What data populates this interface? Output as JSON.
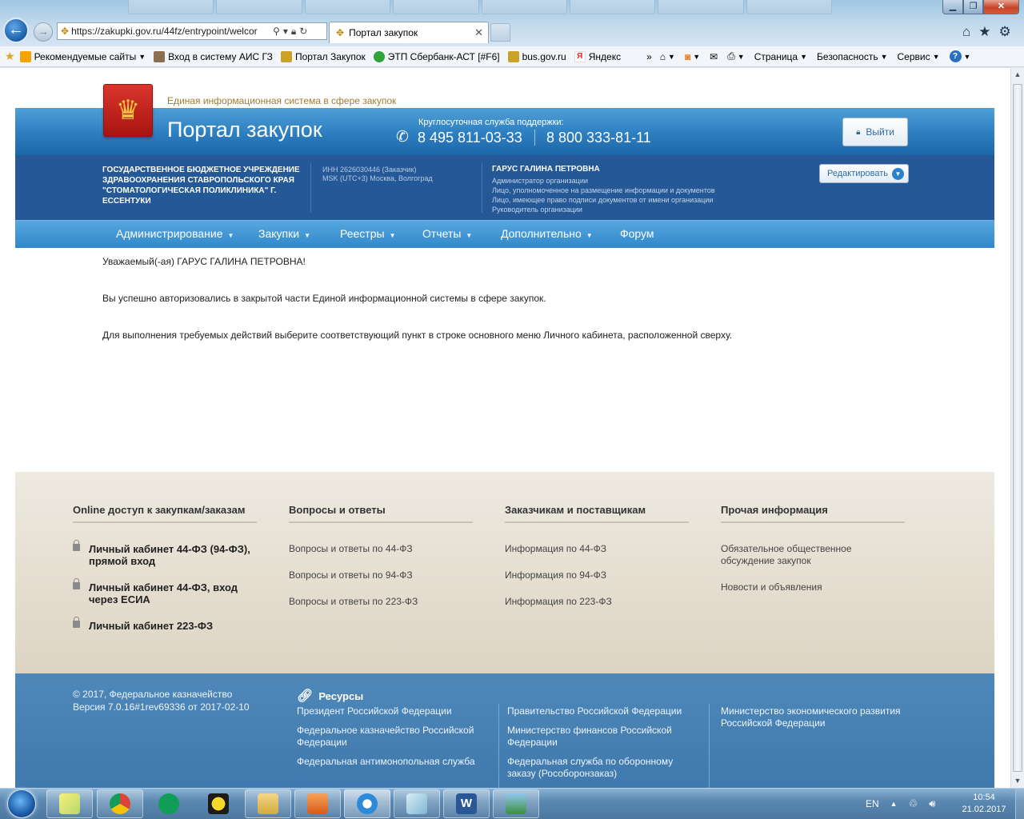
{
  "browser": {
    "address_url": "https://zakupki.gov.ru/44fz/entrypoint/welcor",
    "active_tab_title": "Портал закупок",
    "favorites": [
      {
        "label": "Рекомендуемые сайты",
        "icon": "bing-icon"
      },
      {
        "label": "Вход в систему  АИС ГЗ",
        "icon": "tools-icon"
      },
      {
        "label": "Портал Закупок",
        "icon": "emblem-icon"
      },
      {
        "label": "ЭТП Сбербанк-АСТ [#F6]",
        "icon": "sber-icon"
      },
      {
        "label": "bus.gov.ru",
        "icon": "emblem-icon"
      },
      {
        "label": "Яндекс",
        "icon": "yandex-icon"
      }
    ],
    "command_menus": [
      "Страница",
      "Безопасность",
      "Сервис"
    ]
  },
  "site": {
    "tagline": "Единая информационная система в сфере закупок",
    "title": "Портал закупок",
    "support_label": "Круглосуточная служба поддержки:",
    "phone1": "8 495 811-03-33",
    "phone2": "8 800 333-81-11",
    "logout_label": "Выйти"
  },
  "org": {
    "name": "ГОСУДАРСТВЕННОЕ БЮДЖЕТНОЕ УЧРЕЖДЕНИЕ ЗДРАВООХРАНЕНИЯ СТАВРОПОЛЬСКОГО КРАЯ \"СТОМАТОЛОГИЧЕСКАЯ ПОЛИКЛИНИКА\" Г. ЕССЕНТУКИ",
    "inn": "ИНН 2626030446 (Заказчик)",
    "timezone": "MSK (UTC+3) Москва, Волгоград",
    "user_name": "ГАРУС ГАЛИНА ПЕТРОВНА",
    "roles": [
      "Администратор организации",
      "Лицо, уполномоченное на размещение информации и документов",
      "Лицо, имеющее право подписи документов от имени организации",
      "Руководитель организации"
    ],
    "edit_label": "Редактировать"
  },
  "nav": {
    "items": [
      {
        "label": "Администрирование"
      },
      {
        "label": "Закупки"
      },
      {
        "label": "Реестры"
      },
      {
        "label": "Отчеты"
      },
      {
        "label": "Дополнительно"
      },
      {
        "label": "Форум"
      }
    ]
  },
  "welcome": {
    "greeting": "Уважаемый(-ая) ГАРУС ГАЛИНА ПЕТРОВНА!",
    "line1": "Вы успешно авторизовались в закрытой части Единой информационной системы в сфере закупок.",
    "line2": "Для выполнения требуемых действий выберите соответствующий пункт в строке основного меню Личного кабинета, расположенной сверху."
  },
  "footer": {
    "columns": [
      {
        "title": "Online доступ к закупкам/заказам",
        "links": [
          "Личный кабинет 44-ФЗ (94-ФЗ), прямой вход",
          "Личный кабинет 44-ФЗ, вход через ЕСИА",
          "Личный кабинет 223-ФЗ"
        ]
      },
      {
        "title": "Вопросы и ответы",
        "links": [
          "Вопросы и ответы по 44-ФЗ",
          "Вопросы и ответы по 94-ФЗ",
          "Вопросы и ответы по 223-ФЗ"
        ]
      },
      {
        "title": "Заказчикам и поставщикам",
        "links": [
          "Информация по 44-ФЗ",
          "Информация по 94-ФЗ",
          "Информация по 223-ФЗ"
        ]
      },
      {
        "title": "Прочая информация",
        "links": [
          "Обязательное общественное обсуждение закупок",
          "Новости и объявления"
        ]
      }
    ],
    "copyright": "© 2017, Федеральное казначейство",
    "version": "Версия 7.0.16#1rev69336 от 2017-02-10",
    "resources_title": "Ресурсы",
    "resources": [
      [
        "Президент Российской Федерации",
        "Федеральное казначейство Российской Федерации",
        "Федеральная антимонопольная служба"
      ],
      [
        "Правительство Российской Федерации",
        "Министерство финансов Российской Федерации",
        "Федеральная служба по оборонному заказу (Рособоронзаказ)"
      ],
      [
        "Министерство экономического развития Российской Федерации"
      ]
    ]
  },
  "taskbar": {
    "language": "EN",
    "time": "10:54",
    "date": "21.02.2017"
  }
}
